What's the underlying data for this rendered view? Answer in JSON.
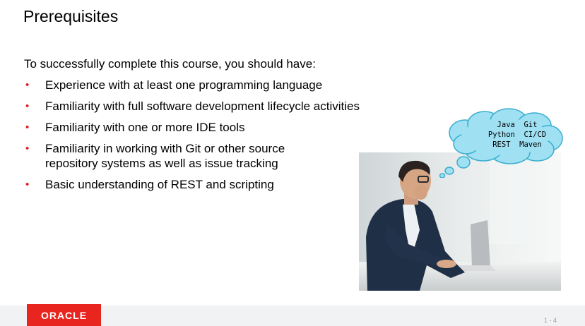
{
  "title": "Prerequisites",
  "intro": "To successfully complete this course, you should have:",
  "bullets": [
    "Experience with at least one programming language",
    "Familiarity with full software development lifecycle activities",
    "Familiarity with one or more IDE tools",
    "Familiarity in working with Git or other source repository systems as well as issue tracking",
    "Basic understanding of REST and scripting"
  ],
  "bullet_marker": "•",
  "cloud_lines": [
    "Java  Git",
    "Python  CI/CD",
    "REST  Maven"
  ],
  "logo_text": "ORACLE",
  "page_number": "1 - 4",
  "colors": {
    "accent": "#e01e24",
    "logo_bg": "#e8251f",
    "cloud_fill": "#9fe0f2",
    "cloud_stroke": "#3aaed0"
  }
}
